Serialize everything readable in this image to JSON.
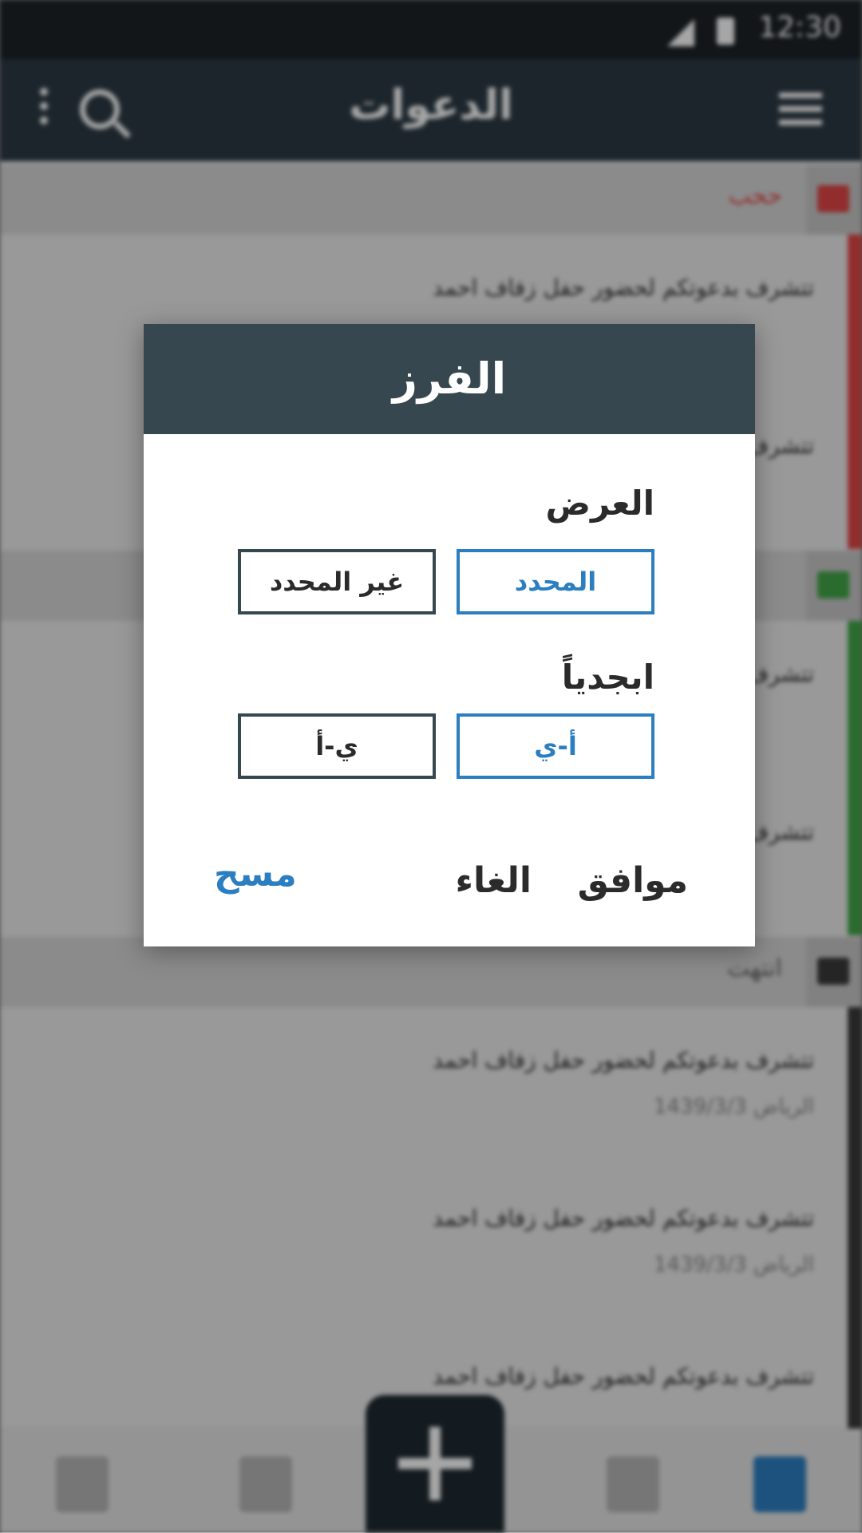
{
  "status_bar": {
    "time": "12:30"
  },
  "app_bar": {
    "title": "الدعوات"
  },
  "background_sections": [
    {
      "label": "ححب",
      "color": "#e04646"
    },
    {
      "label": "",
      "color": "#41a547"
    },
    {
      "label": "انتهت",
      "color": "#3a3a3a"
    }
  ],
  "background_items": [
    {
      "title": "تتشرف بدعوتكم لحضور حفل زفاف احمد",
      "meta": ""
    },
    {
      "title": "تتشرف بدعوتكم لحضور حفل زفاف احمد",
      "meta": ""
    },
    {
      "title": "تتشرف بدعوتكم لحضور حفل زفاف احمد",
      "meta": ""
    },
    {
      "title": "تتشرف بدعوتكم لحضور حفل زفاف احمد",
      "meta": ""
    },
    {
      "title": "تتشرف بدعوتكم لحضور حفل زفاف احمد",
      "meta": "1439/3/3   الرياض"
    },
    {
      "title": "تتشرف بدعوتكم لحضور حفل زفاف احمد",
      "meta": "1439/3/3   الرياض"
    },
    {
      "title": "تتشرف بدعوتكم لحضور حفل زفاف احمد",
      "meta": ""
    }
  ],
  "dialog": {
    "title": "الفرز",
    "display_label": "العرض",
    "display_options": [
      "المحدد",
      "غير المحدد"
    ],
    "display_selected": "المحدد",
    "alpha_label": "ابجدياً",
    "alpha_options": [
      "أ-ي",
      "ي-أ"
    ],
    "alpha_selected": "أ-ي",
    "ok_label": "موافق",
    "cancel_label": "الغاء",
    "clear_label": "مسح"
  },
  "colors": {
    "accent": "#2b7fc1",
    "header": "#37474f",
    "app_bar": "#2c3a44"
  }
}
